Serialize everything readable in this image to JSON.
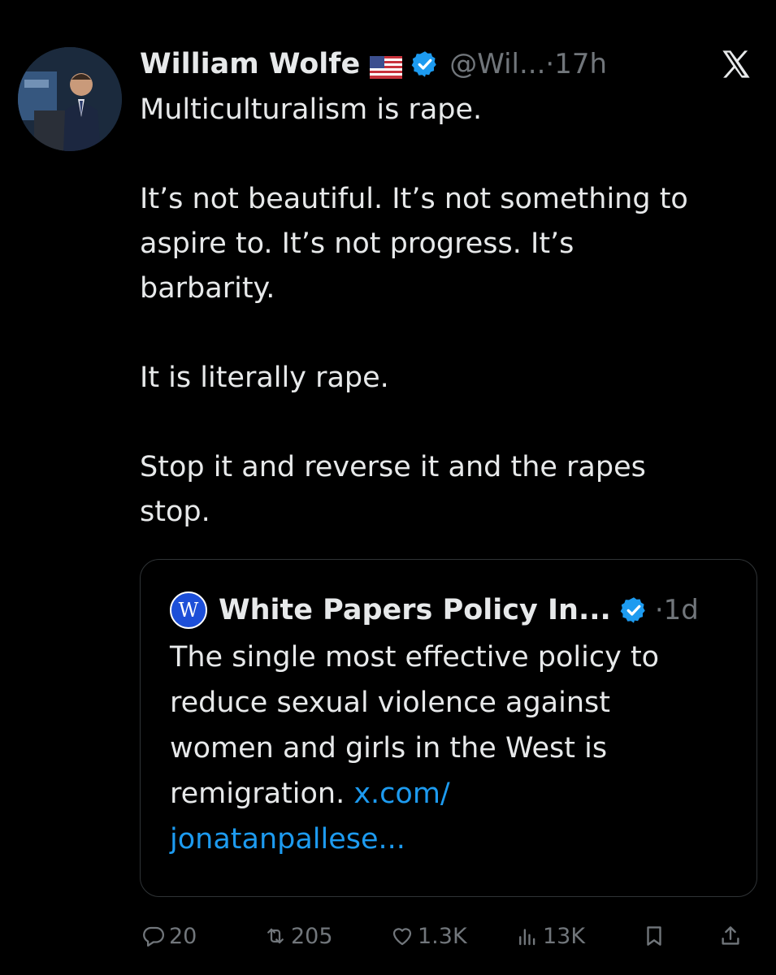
{
  "author": {
    "name": "William Wolfe",
    "flag": "us-flag-emoji",
    "verified": true,
    "handle": "@Wil...",
    "separator": "·",
    "time": "17h"
  },
  "tweet": {
    "paragraphs": [
      "Multiculturalism is rape.",
      "It’s not beautiful. It’s not something to\naspire to. It’s not progress. It’s\nbarbarity.",
      "It is literally rape.",
      "Stop it and reverse it and the rapes\nstop."
    ]
  },
  "quote": {
    "avatar_letter": "W",
    "name": "White Papers Policy In...",
    "verified": true,
    "separator": "·",
    "time": "1d",
    "text": "The single most effective policy to\nreduce sexual violence against\nwomen and girls in the West is\nremigration. ",
    "link": "x.com/\njonatanpallese..."
  },
  "actions": {
    "replies": "20",
    "reposts": "205",
    "likes": "1.3K",
    "views": "13K",
    "icons": [
      "reply-icon",
      "repost-icon",
      "like-icon",
      "views-icon",
      "bookmark-icon",
      "share-icon"
    ]
  },
  "colors": {
    "background": "#000000",
    "text": "#e7e9ea",
    "muted": "#71767b",
    "link": "#1d9bf0",
    "verified": "#1d9bf0",
    "border": "#2f3336"
  }
}
